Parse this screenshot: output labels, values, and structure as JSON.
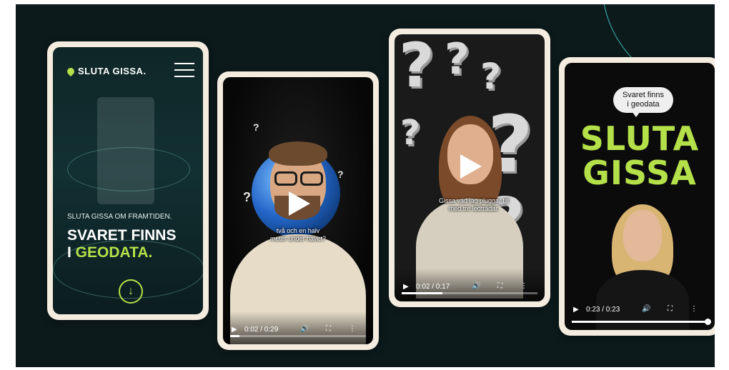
{
  "phone1": {
    "brand": "SLUTA GISSA.",
    "subtitle": "SLUTA GISSA OM FRAMTIDEN.",
    "headline_line1": "SVARET FINNS",
    "headline_line2_prefix": "I ",
    "headline_line2_accent": "GEODATA.",
    "down_icon": "↓"
  },
  "video1": {
    "caption_line1": "två och en halv",
    "caption_line2": "meter under havet?",
    "time": "0:02 / 0:29",
    "progress": 0.07
  },
  "video2": {
    "caption_line1": "Gissa vad jag pluggar till",
    "caption_line2": "med tre ledtrådar.",
    "time": "0:02 / 0:17",
    "progress": 0.3
  },
  "video3": {
    "bubble_line1": "Svaret finns",
    "bubble_line2": "i geodata",
    "title_line1": "SLUTA",
    "title_line2": "GISSA",
    "time": "0:23 / 0:23",
    "progress": 1.0
  },
  "control_icons": {
    "play": "▶",
    "volume": "🔊",
    "fullscreen": "⛶",
    "more": "⋮"
  },
  "qmarks": {
    "symbol": "?"
  },
  "colors": {
    "background": "#0c1a1c",
    "frame": "#f4ecdf",
    "accent": "#b4e04a",
    "deco_line": "#3db9b4"
  }
}
